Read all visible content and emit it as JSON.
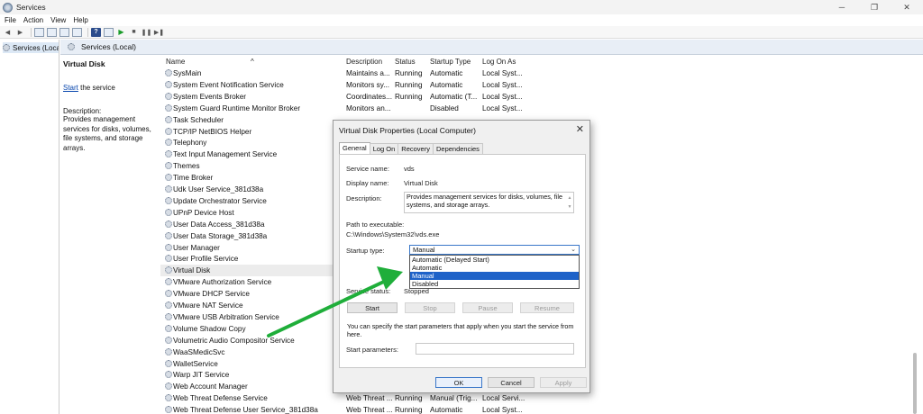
{
  "window": {
    "title": "Services"
  },
  "menu": [
    "File",
    "Action",
    "View",
    "Help"
  ],
  "tree": {
    "item": "Services (Local"
  },
  "main": {
    "header": "Services (Local)"
  },
  "desc": {
    "title": "Virtual Disk",
    "start_link": "Start",
    "start_rest": " the service",
    "label": "Description:",
    "text": "Provides management services for disks, volumes, file systems, and storage arrays."
  },
  "columns": {
    "name": "Name",
    "description": "Description",
    "status": "Status",
    "startup": "Startup Type",
    "logon": "Log On As"
  },
  "rows": [
    {
      "name": "SysMain",
      "desc": "Maintains a...",
      "status": "Running",
      "startup": "Automatic",
      "logon": "Local Syst..."
    },
    {
      "name": "System Event Notification Service",
      "desc": "Monitors sy...",
      "status": "Running",
      "startup": "Automatic",
      "logon": "Local Syst..."
    },
    {
      "name": "System Events Broker",
      "desc": "Coordinates...",
      "status": "Running",
      "startup": "Automatic (T...",
      "logon": "Local Syst..."
    },
    {
      "name": "System Guard Runtime Monitor Broker",
      "desc": "Monitors an...",
      "status": "",
      "startup": "Disabled",
      "logon": "Local Syst..."
    },
    {
      "name": "Task Scheduler",
      "desc": "",
      "status": "",
      "startup": "",
      "logon": ""
    },
    {
      "name": "TCP/IP NetBIOS Helper",
      "desc": "",
      "status": "",
      "startup": "",
      "logon": ""
    },
    {
      "name": "Telephony",
      "desc": "",
      "status": "",
      "startup": "",
      "logon": ""
    },
    {
      "name": "Text Input Management Service",
      "desc": "",
      "status": "",
      "startup": "",
      "logon": ""
    },
    {
      "name": "Themes",
      "desc": "",
      "status": "",
      "startup": "",
      "logon": ""
    },
    {
      "name": "Time Broker",
      "desc": "",
      "status": "",
      "startup": "",
      "logon": ""
    },
    {
      "name": "Udk User Service_381d38a",
      "desc": "",
      "status": "",
      "startup": "",
      "logon": ""
    },
    {
      "name": "Update Orchestrator Service",
      "desc": "",
      "status": "",
      "startup": "",
      "logon": ""
    },
    {
      "name": "UPnP Device Host",
      "desc": "",
      "status": "",
      "startup": "",
      "logon": ""
    },
    {
      "name": "User Data Access_381d38a",
      "desc": "",
      "status": "",
      "startup": "",
      "logon": ""
    },
    {
      "name": "User Data Storage_381d38a",
      "desc": "",
      "status": "",
      "startup": "",
      "logon": ""
    },
    {
      "name": "User Manager",
      "desc": "",
      "status": "",
      "startup": "",
      "logon": ""
    },
    {
      "name": "User Profile Service",
      "desc": "",
      "status": "",
      "startup": "",
      "logon": ""
    },
    {
      "name": "Virtual Disk",
      "desc": "",
      "status": "",
      "startup": "",
      "logon": ""
    },
    {
      "name": "VMware Authorization Service",
      "desc": "",
      "status": "",
      "startup": "",
      "logon": ""
    },
    {
      "name": "VMware DHCP Service",
      "desc": "",
      "status": "",
      "startup": "",
      "logon": ""
    },
    {
      "name": "VMware NAT Service",
      "desc": "",
      "status": "",
      "startup": "",
      "logon": ""
    },
    {
      "name": "VMware USB Arbitration Service",
      "desc": "",
      "status": "",
      "startup": "",
      "logon": ""
    },
    {
      "name": "Volume Shadow Copy",
      "desc": "",
      "status": "",
      "startup": "",
      "logon": ""
    },
    {
      "name": "Volumetric Audio Compositor Service",
      "desc": "",
      "status": "",
      "startup": "",
      "logon": ""
    },
    {
      "name": "WaaSMedicSvc",
      "desc": "",
      "status": "",
      "startup": "",
      "logon": ""
    },
    {
      "name": "WalletService",
      "desc": "",
      "status": "",
      "startup": "",
      "logon": ""
    },
    {
      "name": "Warp JIT Service",
      "desc": "",
      "status": "",
      "startup": "",
      "logon": ""
    },
    {
      "name": "Web Account Manager",
      "desc": "",
      "status": "",
      "startup": "",
      "logon": ""
    },
    {
      "name": "Web Threat Defense Service",
      "desc": "Web Threat ...",
      "status": "Running",
      "startup": "Manual (Trig...",
      "logon": "Local Servi..."
    },
    {
      "name": "Web Threat Defense User Service_381d38a",
      "desc": "Web Threat ...",
      "status": "Running",
      "startup": "Automatic",
      "logon": "Local Syst..."
    }
  ],
  "dialog": {
    "title": "Virtual Disk Properties (Local Computer)",
    "tabs": [
      "General",
      "Log On",
      "Recovery",
      "Dependencies"
    ],
    "service_name_label": "Service name:",
    "service_name": "vds",
    "display_name_label": "Display name:",
    "display_name": "Virtual Disk",
    "description_label": "Description:",
    "description": "Provides management services for disks, volumes, file systems, and storage arrays.",
    "path_label": "Path to executable:",
    "path": "C:\\Windows\\System32\\vds.exe",
    "startup_label": "Startup type:",
    "startup_value": "Manual",
    "startup_options": [
      "Automatic (Delayed Start)",
      "Automatic",
      "Manual",
      "Disabled"
    ],
    "status_label": "Service status:",
    "status_value": "Stopped",
    "btn_start": "Start",
    "btn_stop": "Stop",
    "btn_pause": "Pause",
    "btn_resume": "Resume",
    "note": "You can specify the start parameters that apply when you start the service from here.",
    "params_label": "Start parameters:",
    "params_value": "",
    "btn_ok": "OK",
    "btn_cancel": "Cancel",
    "btn_apply": "Apply"
  },
  "colors": {
    "selection": "#1e62c8",
    "arrow": "#1fae3a"
  }
}
